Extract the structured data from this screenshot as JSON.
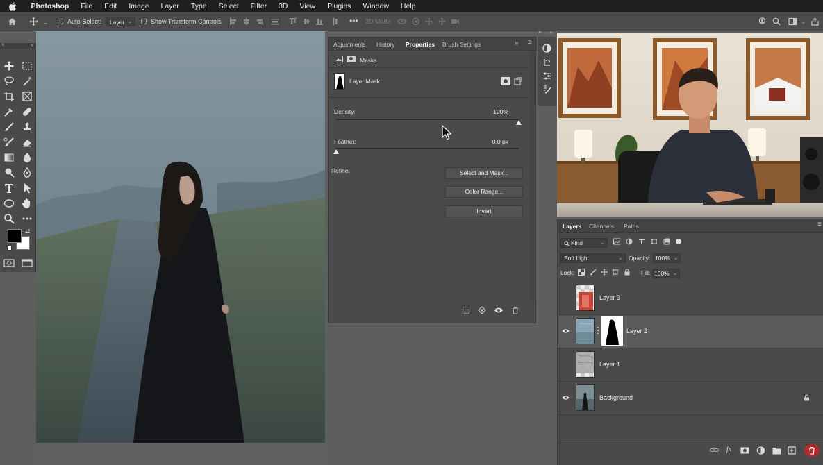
{
  "menubar": {
    "app_name": "Photoshop",
    "items": [
      "File",
      "Edit",
      "Image",
      "Layer",
      "Type",
      "Select",
      "Filter",
      "3D",
      "View",
      "Plugins",
      "Window",
      "Help"
    ]
  },
  "options_bar": {
    "auto_select_label": "Auto-Select:",
    "auto_select_target": "Layer",
    "show_transform_label": "Show Transform Controls",
    "mode_3d_label": "3D Mode:"
  },
  "properties": {
    "tabs": [
      "Adjustments",
      "History",
      "Properties",
      "Brush Settings"
    ],
    "active_tab": "Properties",
    "section_title": "Masks",
    "mask_name": "Layer Mask",
    "density_label": "Density:",
    "density_value": "100%",
    "density_level": 1.0,
    "feather_label": "Feather:",
    "feather_value": "0.0 px",
    "feather_level": 0.0,
    "refine_label": "Refine:",
    "buttons": {
      "select_and_mask": "Select and Mask...",
      "color_range": "Color Range...",
      "invert": "Invert"
    }
  },
  "layers_panel": {
    "tabs": [
      "Layers",
      "Channels",
      "Paths"
    ],
    "active_tab": "Layers",
    "filter_kind": "Kind",
    "blend_mode": "Soft Light",
    "opacity_label": "Opacity:",
    "opacity_value": "100%",
    "lock_label": "Lock:",
    "fill_label": "Fill:",
    "fill_value": "100%",
    "layers": [
      {
        "name": "Layer 3",
        "visible": false,
        "selected": false
      },
      {
        "name": "Layer 2",
        "visible": true,
        "selected": true,
        "has_mask": true
      },
      {
        "name": "Layer 1",
        "visible": false,
        "selected": false
      },
      {
        "name": "Background",
        "visible": true,
        "selected": false,
        "locked": true
      }
    ]
  },
  "colors": {
    "panel_bg": "#4a4a4a",
    "menubar_bg": "#1f1f1f",
    "selected_row": "#5a5a5a",
    "foreground_swatch": "#000000",
    "background_swatch": "#ffffff"
  }
}
